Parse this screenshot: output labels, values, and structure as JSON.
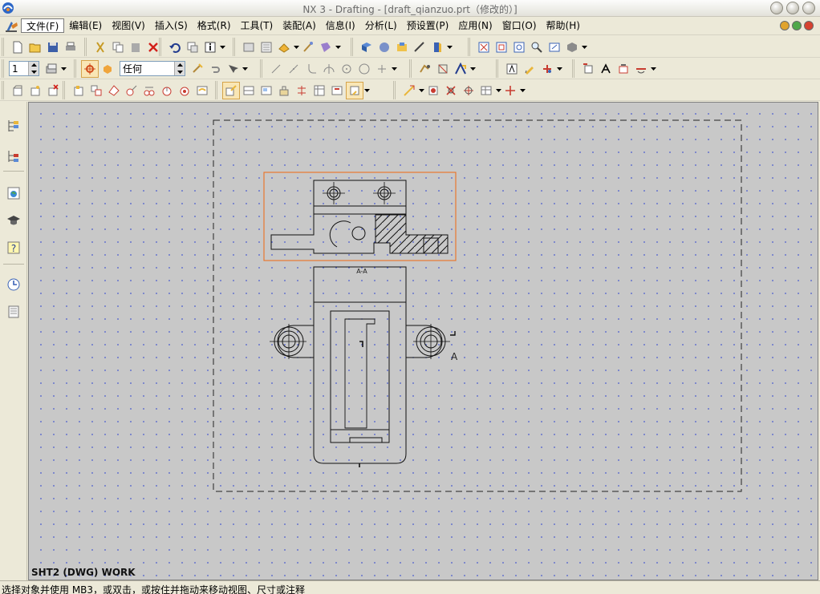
{
  "window": {
    "title": "NX 3 - Drafting - [draft_qianzuo.prt（修改的）]"
  },
  "menubar": {
    "items": [
      {
        "label": "文件(F)"
      },
      {
        "label": "编辑(E)"
      },
      {
        "label": "视图(V)"
      },
      {
        "label": "插入(S)"
      },
      {
        "label": "格式(R)"
      },
      {
        "label": "工具(T)"
      },
      {
        "label": "装配(A)"
      },
      {
        "label": "信息(I)"
      },
      {
        "label": "分析(L)"
      },
      {
        "label": "预设置(P)"
      },
      {
        "label": "应用(N)"
      },
      {
        "label": "窗口(O)"
      },
      {
        "label": "帮助(H)"
      }
    ]
  },
  "toolbar": {
    "layer_value": "1",
    "filter_value": "任何"
  },
  "drawing": {
    "section_label": "A-A",
    "section_arrow_label": "A"
  },
  "graphics": {
    "sheet_label": "SHT2 (DWG) WORK"
  },
  "statusbar": {
    "prompt": "选择对象并使用 MB3，或双击，或按住并拖动来移动视图、尺寸或注释"
  },
  "colors": {
    "selection_border": "#e8772e",
    "grid_dot": "#3a4fd0",
    "canvas_bg": "#c8c8c8"
  }
}
